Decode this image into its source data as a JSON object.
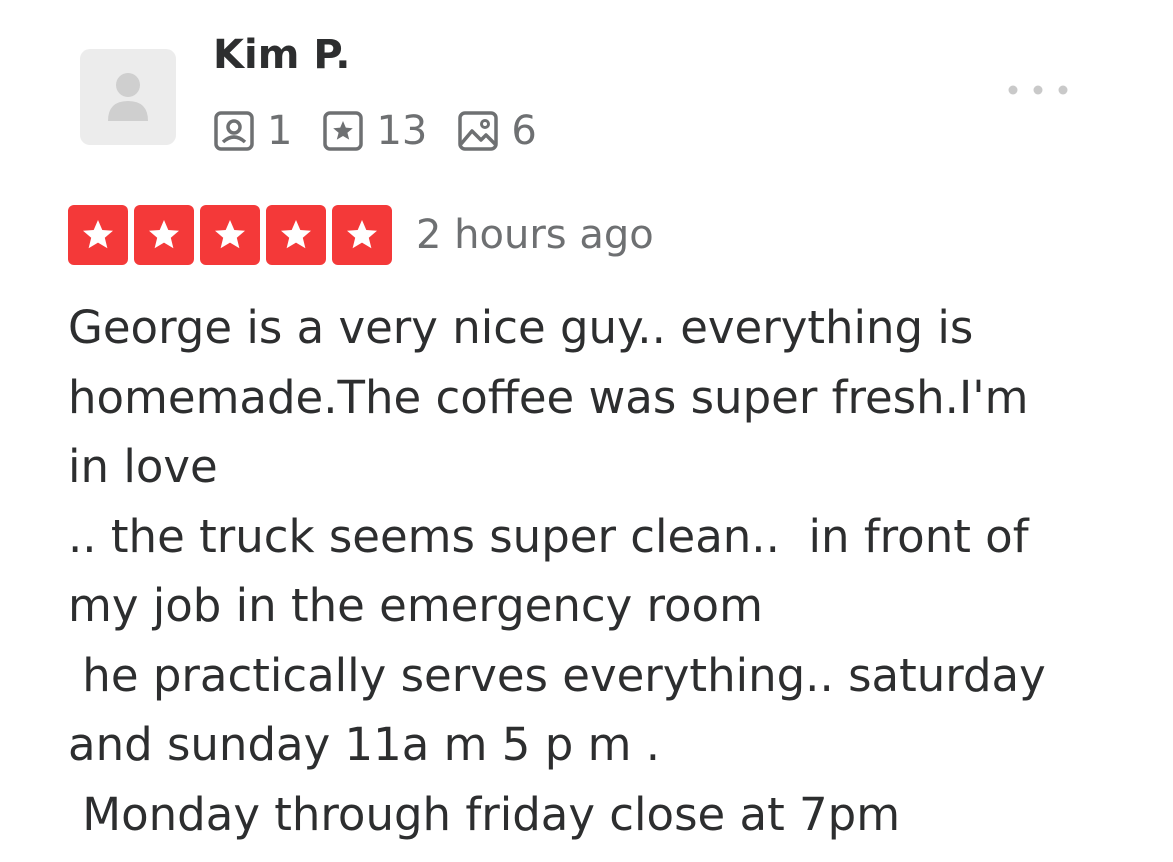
{
  "review": {
    "user": {
      "name": "Kim P.",
      "avatar_icon": "default-user-avatar-icon",
      "stats": {
        "friends": "1",
        "reviews": "13",
        "photos": "6"
      }
    },
    "menu_icon": "more-options-icon",
    "rating": {
      "stars": 5,
      "max": 5,
      "color": "#f43939"
    },
    "time_ago": "2 hours ago",
    "text_lines": [
      "George is a very nice guy.. everything is",
      "homemade.The coffee was super fresh.I'm",
      "in love",
      ".. the truck seems super clean..  in front of",
      "my job in the emergency room",
      " he practically serves everything.. saturday",
      "and sunday 11a m 5 p m .",
      " Monday through friday close at 7pm"
    ]
  },
  "colors": {
    "text_primary": "#2d2e2f",
    "text_secondary": "#6e7072",
    "star_red": "#f43939",
    "avatar_bg": "#ececec"
  }
}
